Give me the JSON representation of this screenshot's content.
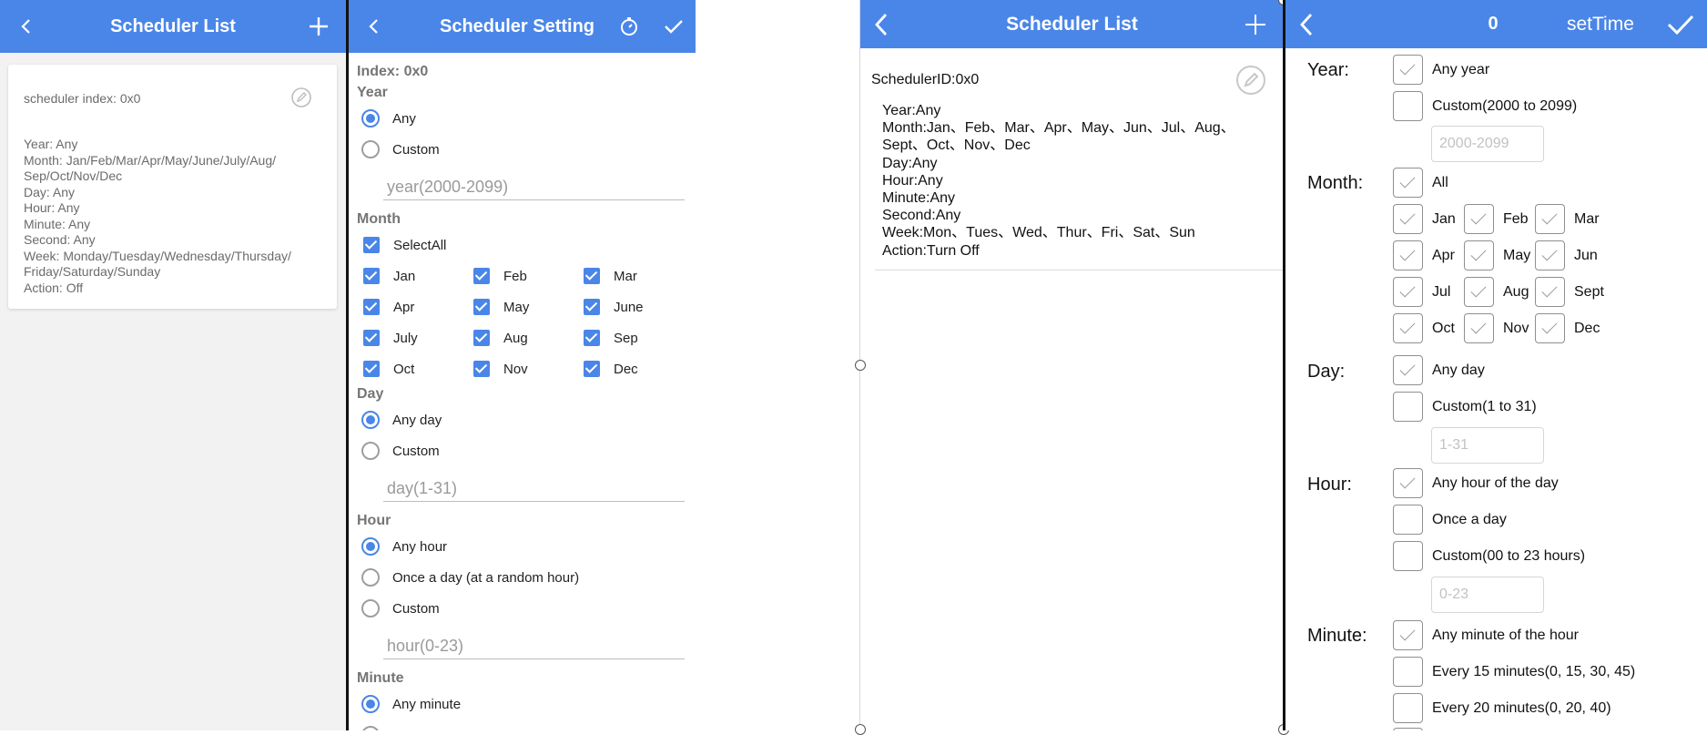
{
  "panel1": {
    "header": {
      "title": "Scheduler List",
      "back": "‹",
      "add": "+"
    },
    "card": {
      "title": "scheduler index: 0x0",
      "lines": [
        "Year: Any",
        "Month: Jan/Feb/Mar/Apr/May/June/July/Aug/",
        "Sep/Oct/Nov/Dec",
        "Day: Any",
        "Hour: Any",
        "Minute: Any",
        "Second: Any",
        "Week: Monday/Tuesday/Wednesday/Thursday/",
        "Friday/Saturday/Sunday",
        "Action: Off"
      ]
    }
  },
  "panel2": {
    "header": {
      "title": "Scheduler Setting",
      "back": "‹"
    },
    "index_label": "Index: 0x0",
    "year": {
      "title": "Year",
      "any": "Any",
      "custom": "Custom",
      "placeholder": "year(2000-2099)"
    },
    "month": {
      "title": "Month",
      "select_all": "SelectAll",
      "months": [
        "Jan",
        "Feb",
        "Mar",
        "Apr",
        "May",
        "June",
        "July",
        "Aug",
        "Sep",
        "Oct",
        "Nov",
        "Dec"
      ]
    },
    "day": {
      "title": "Day",
      "any": "Any day",
      "custom": "Custom",
      "placeholder": "day(1-31)"
    },
    "hour": {
      "title": "Hour",
      "any": "Any hour",
      "once": "Once a day (at a random hour)",
      "custom": "Custom",
      "placeholder": "hour(0-23)"
    },
    "minute": {
      "title": "Minute",
      "any": "Any minute"
    }
  },
  "panel3": {
    "header": {
      "title": "Scheduler List"
    },
    "scheduler_id": "SchedulerID:0x0",
    "lines": [
      "Year:Any",
      "Month:Jan、Feb、Mar、Apr、May、Jun、Jul、Aug、",
      "Sept、Oct、Nov、Dec",
      "Day:Any",
      "Hour:Any",
      "Minute:Any",
      "Second:Any",
      "Week:Mon、Tues、Wed、Thur、Fri、Sat、Sun",
      "Action:Turn Off"
    ]
  },
  "panel4": {
    "header": {
      "index": "0",
      "title": "setTime"
    },
    "year": {
      "label": "Year:",
      "any": "Any year",
      "custom": "Custom(2000 to 2099)",
      "placeholder": "2000-2099"
    },
    "month": {
      "label": "Month:",
      "all": "All",
      "months": [
        "Jan",
        "Feb",
        "Mar",
        "Apr",
        "May",
        "Jun",
        "Jul",
        "Aug",
        "Sept",
        "Oct",
        "Nov",
        "Dec"
      ]
    },
    "day": {
      "label": "Day:",
      "any": "Any day",
      "custom": "Custom(1 to 31)",
      "placeholder": "1-31"
    },
    "hour": {
      "label": "Hour:",
      "any": "Any hour of the day",
      "once": "Once a day",
      "custom": "Custom(00 to 23 hours)",
      "placeholder": "0-23"
    },
    "minute": {
      "label": "Minute:",
      "any": "Any minute of the hour",
      "every15": "Every 15 minutes(0, 15, 30, 45)",
      "every20": "Every 20 minutes(0, 20, 40)"
    }
  },
  "colors": {
    "accent": "#4a86e8"
  }
}
